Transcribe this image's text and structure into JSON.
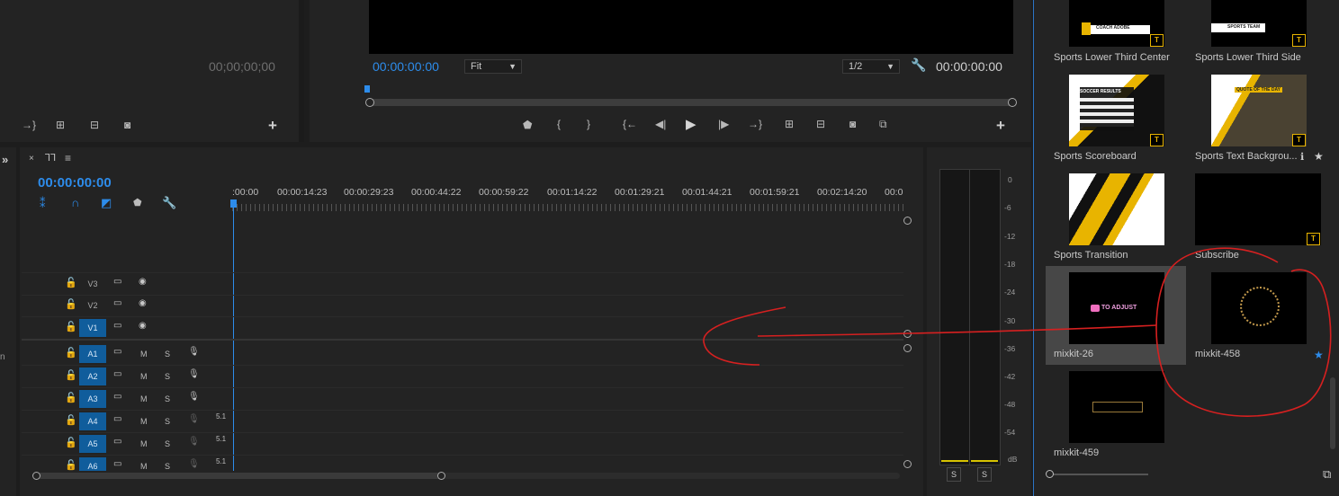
{
  "source_monitor": {
    "timecode": "00;00;00;00"
  },
  "program_monitor": {
    "timecode_left": "00:00:00:00",
    "fit_label": "Fit",
    "resolution_label": "1/2",
    "timecode_right": "00:00:00:00",
    "controls": [
      "marker-icon",
      "mark-in-icon",
      "mark-out-icon",
      "go-to-in-icon",
      "step-back-icon",
      "play-icon",
      "step-forward-icon",
      "go-to-out-icon",
      "lift-icon",
      "extract-icon",
      "export-frame-icon",
      "comparison-view-icon"
    ]
  },
  "timeline": {
    "timecode": "00:00:00:00",
    "ruler": [
      ":00:00",
      "00:00:14:23",
      "00:00:29:23",
      "00:00:44:22",
      "00:00:59:22",
      "00:01:14:22",
      "00:01:29:21",
      "00:01:44:21",
      "00:01:59:21",
      "00:02:14:20",
      "00:0"
    ],
    "tracks": [
      {
        "label": "V3",
        "type": "video",
        "active": false
      },
      {
        "label": "V2",
        "type": "video",
        "active": false
      },
      {
        "label": "V1",
        "type": "video",
        "active": true
      },
      {
        "label": "A1",
        "type": "audio",
        "active": true,
        "ch": ""
      },
      {
        "label": "A2",
        "type": "audio",
        "active": true,
        "ch": ""
      },
      {
        "label": "A3",
        "type": "audio",
        "active": true,
        "ch": ""
      },
      {
        "label": "A4",
        "type": "audio",
        "active": true,
        "ch": "5.1"
      },
      {
        "label": "A5",
        "type": "audio",
        "active": true,
        "ch": "5.1"
      },
      {
        "label": "A6",
        "type": "audio",
        "active": true,
        "ch": "5.1"
      }
    ],
    "m_label": "M",
    "s_label": "S"
  },
  "audio_meter": {
    "scale": [
      "0",
      "-6",
      "-12",
      "-18",
      "-24",
      "-30",
      "-36",
      "-42",
      "-48",
      "-54",
      "dB"
    ],
    "solo_left": "S",
    "solo_right": "S"
  },
  "graphics_panel": {
    "items": [
      {
        "name": "Sports Lower Third Center",
        "thumb_text": "COACH ADOBE"
      },
      {
        "name": "Sports Lower Third Side",
        "thumb_text": "SPORTS TEAM"
      },
      {
        "name": "Sports Scoreboard",
        "thumb_text": "SOCCER RESULTS"
      },
      {
        "name": "Sports Text Backgrou...",
        "thumb_text": "QUOTE OF THE DAY"
      },
      {
        "name": "Sports Transition",
        "thumb_text": ""
      },
      {
        "name": "Subscribe",
        "thumb_text": ""
      },
      {
        "name": "mixkit-26",
        "thumb_text": "TO ADJUST"
      },
      {
        "name": "mixkit-458",
        "thumb_text": ""
      },
      {
        "name": "mixkit-459",
        "thumb_text": ""
      }
    ],
    "tag_text": "T"
  },
  "colors": {
    "accent_blue": "#2d8ceb",
    "track_active": "#105d9c",
    "annotation_red": "#d62020",
    "graphics_yellow": "#e8b400"
  }
}
